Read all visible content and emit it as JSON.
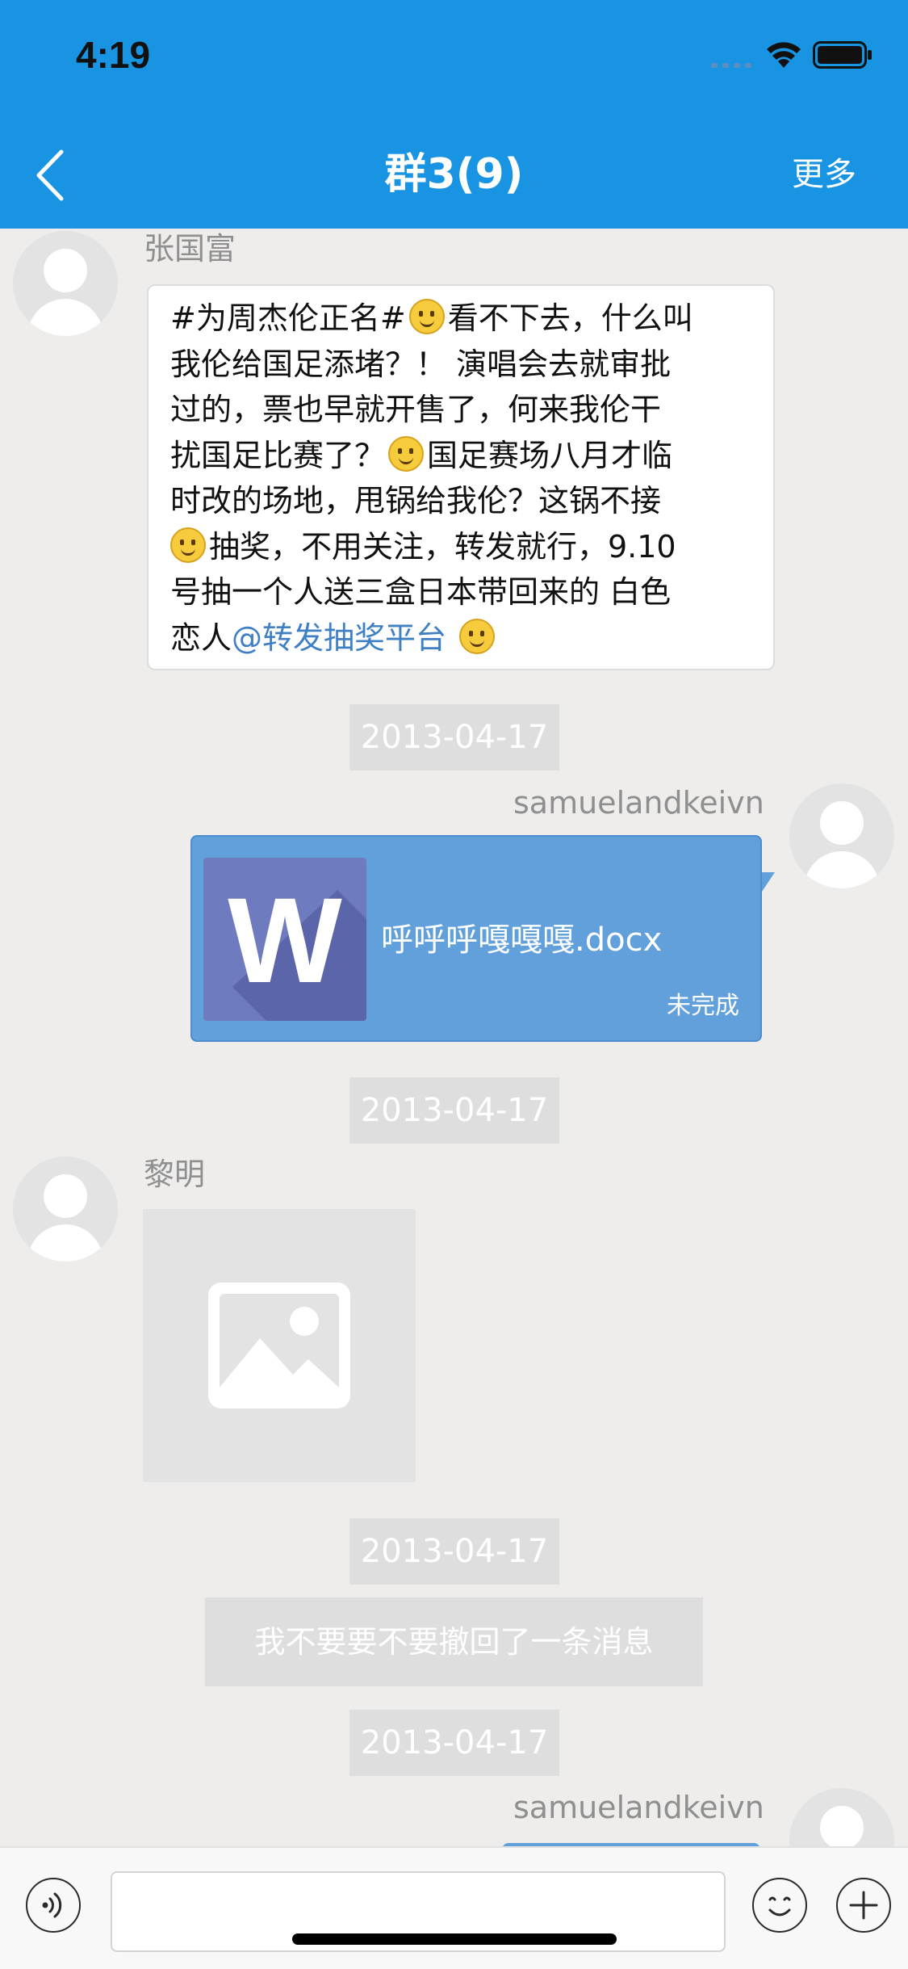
{
  "status_bar": {
    "time": "4:19"
  },
  "nav": {
    "title": "群3(9)",
    "more_label": "更多"
  },
  "messages": [
    {
      "sender": "张国富",
      "lines": [
        {
          "before_emoji": "#为周杰伦正名#",
          "after_emoji": "看不下去，什么叫",
          "emoji": "thinking-emoji"
        },
        {
          "text": "我伦给国足添堵？！ 演唱会去就审批"
        },
        {
          "text": "过的，票也早就开售了，何来我伦干"
        },
        {
          "before_emoji": "扰国足比赛了？",
          "after_emoji": "国足赛场八月才临",
          "emoji": "smile-emoji"
        },
        {
          "text": "时改的场地，甩锅给我伦？这锅不接"
        },
        {
          "before_emoji": "",
          "after_emoji": "抽奖，不用关注，转发就行，9.10",
          "emoji": "smile-emoji"
        },
        {
          "text": "号抽一个人送三盒日本带回来的 白色"
        },
        {
          "prefix": "恋人",
          "mention": "@转发抽奖平台",
          "emoji": "thinking-emoji"
        }
      ]
    }
  ],
  "timestamps": [
    "2013-04-17",
    "2013-04-17",
    "2013-04-17",
    "2013-04-17"
  ],
  "file_message": {
    "sender": "samuelandkeivn",
    "icon_letter": "W",
    "file_name": "呼呼呼嘎嘎嘎.docx",
    "status": "未完成"
  },
  "image_message": {
    "sender": "黎明",
    "icon": "image-placeholder-icon"
  },
  "recall_notice": "我不要要不要撤回了一条消息",
  "last_message": {
    "sender": "samuelandkeivn"
  },
  "input_bar": {
    "voice_icon": "voice-icon",
    "emoji_icon": "emoji-icon",
    "add_icon": "plus-icon",
    "value": ""
  },
  "colors": {
    "header": "#1894e2",
    "background": "#eeedeb",
    "bubble_self": "#62a0dc",
    "word_icon": "#6f7bbf",
    "mention": "#3f7fc4"
  }
}
